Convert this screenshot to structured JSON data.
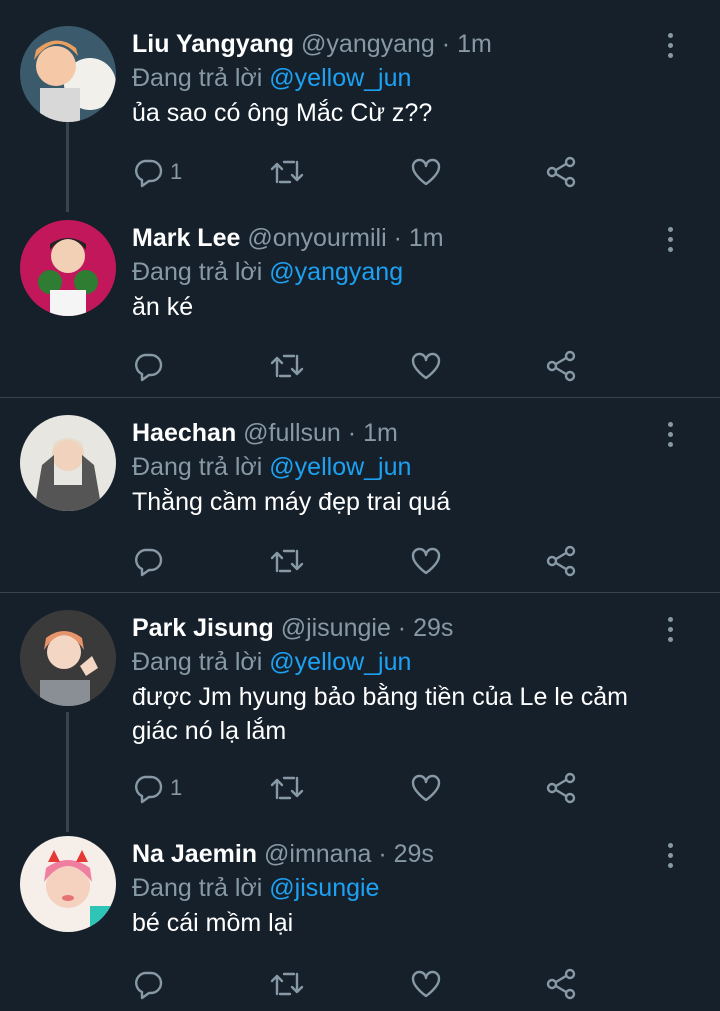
{
  "reply_prefix": "Đang trả lời",
  "dot": "·",
  "colors": {
    "background": "#15202b",
    "muted": "#8899a6",
    "mention": "#1da1f2",
    "divider": "#38444d"
  },
  "tweets": [
    {
      "name": "Liu Yangyang",
      "handle": "@yangyang",
      "time": "1m",
      "reply_to": "@yellow_jun",
      "text": "ủa sao có ông Mắc Cừ z??",
      "reply_count": "1"
    },
    {
      "name": "Mark Lee",
      "handle": "@onyourmili",
      "time": "1m",
      "reply_to": "@yangyang",
      "text": "ăn ké",
      "reply_count": ""
    },
    {
      "name": "Haechan",
      "handle": "@fullsun",
      "time": "1m",
      "reply_to": "@yellow_jun",
      "text": "Thằng cầm máy đẹp trai quá",
      "reply_count": ""
    },
    {
      "name": "Park Jisung",
      "handle": "@jisungie",
      "time": "29s",
      "reply_to": "@yellow_jun",
      "text": "được Jm hyung bảo bằng tiền của Le le cảm giác nó lạ lắm",
      "reply_count": "1"
    },
    {
      "name": "Na Jaemin",
      "handle": "@imnana",
      "time": "29s",
      "reply_to": "@jisungie",
      "text": "bé cái mồm lại",
      "reply_count": ""
    }
  ],
  "icons": [
    "reply-icon",
    "retweet-icon",
    "like-icon",
    "share-icon",
    "more-icon"
  ]
}
